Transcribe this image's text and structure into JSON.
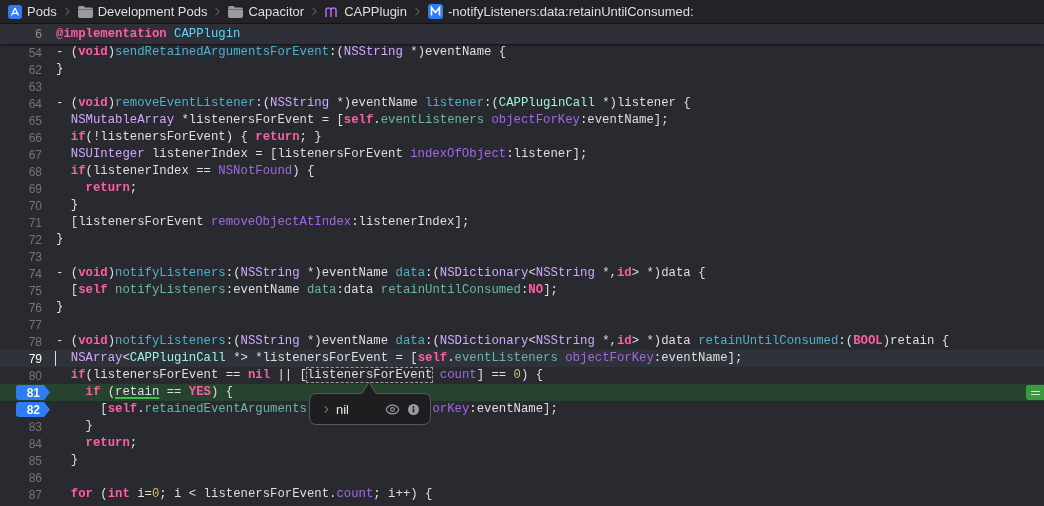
{
  "breadcrumbs": [
    {
      "kind": "project",
      "label": "Pods"
    },
    {
      "kind": "folder",
      "label": "Development Pods"
    },
    {
      "kind": "folder",
      "label": "Capacitor"
    },
    {
      "kind": "class",
      "label": "CAPPlugin"
    },
    {
      "kind": "method",
      "label": "-notifyListeners:data:retainUntilConsumed:"
    }
  ],
  "sticky_header": {
    "number": "6",
    "tokens": [
      {
        "kind": "kw",
        "text": "@implementation "
      },
      {
        "kind": "cls",
        "text": "CAPPlugin"
      }
    ]
  },
  "lines": [
    {
      "number": "54",
      "breakpoint": false,
      "current": false,
      "focused": false,
      "tokens": [
        {
          "kind": "p",
          "text": "- ("
        },
        {
          "kind": "kw",
          "text": "void"
        },
        {
          "kind": "p",
          "text": ")"
        },
        {
          "kind": "decl",
          "text": "sendRetainedArgumentsForEvent"
        },
        {
          "kind": "p",
          "text": ":("
        },
        {
          "kind": "sys",
          "text": "NSString"
        },
        {
          "kind": "p",
          "text": " *)eventName {"
        }
      ]
    },
    {
      "number": "62",
      "breakpoint": false,
      "current": false,
      "focused": false,
      "tokens": [
        {
          "kind": "p",
          "text": "}"
        }
      ]
    },
    {
      "number": "63",
      "breakpoint": false,
      "current": false,
      "focused": false
    },
    {
      "number": "64",
      "breakpoint": false,
      "current": false,
      "focused": false,
      "tokens": [
        {
          "kind": "p",
          "text": "- ("
        },
        {
          "kind": "kw",
          "text": "void"
        },
        {
          "kind": "p",
          "text": ")"
        },
        {
          "kind": "decl",
          "text": "removeEventListener"
        },
        {
          "kind": "p",
          "text": ":("
        },
        {
          "kind": "sys",
          "text": "NSString"
        },
        {
          "kind": "p",
          "text": " *)eventName "
        },
        {
          "kind": "decl",
          "text": "listener"
        },
        {
          "kind": "p",
          "text": ":("
        },
        {
          "kind": "proj",
          "text": "CAPPluginCall"
        },
        {
          "kind": "p",
          "text": " *)listener {"
        }
      ]
    },
    {
      "number": "65",
      "breakpoint": false,
      "current": false,
      "focused": false,
      "tokens": [
        {
          "kind": "sys",
          "text": "  NSMutableArray"
        },
        {
          "kind": "p",
          "text": " *listenersForEvent = ["
        },
        {
          "kind": "kw",
          "text": "self"
        },
        {
          "kind": "p",
          "text": "."
        },
        {
          "kind": "mem",
          "text": "eventListeners"
        },
        {
          "kind": "call",
          "text": " objectForKey"
        },
        {
          "kind": "p",
          "text": ":eventName];"
        }
      ]
    },
    {
      "number": "66",
      "breakpoint": false,
      "current": false,
      "focused": false,
      "tokens": [
        {
          "kind": "kw",
          "text": "  if"
        },
        {
          "kind": "p",
          "text": "(!listenersForEvent) { "
        },
        {
          "kind": "kw",
          "text": "return"
        },
        {
          "kind": "p",
          "text": "; }"
        }
      ]
    },
    {
      "number": "67",
      "breakpoint": false,
      "current": false,
      "focused": false,
      "tokens": [
        {
          "kind": "sys",
          "text": "  NSUInteger"
        },
        {
          "kind": "p",
          "text": " listenerIndex = [listenersForEvent "
        },
        {
          "kind": "call",
          "text": "indexOfObject"
        },
        {
          "kind": "p",
          "text": ":listener];"
        }
      ]
    },
    {
      "number": "68",
      "breakpoint": false,
      "current": false,
      "focused": false,
      "tokens": [
        {
          "kind": "kw",
          "text": "  if"
        },
        {
          "kind": "p",
          "text": "(listenerIndex == "
        },
        {
          "kind": "call",
          "text": "NSNotFound"
        },
        {
          "kind": "p",
          "text": ") {"
        }
      ]
    },
    {
      "number": "69",
      "breakpoint": false,
      "current": false,
      "focused": false,
      "tokens": [
        {
          "kind": "kw",
          "text": "    return"
        },
        {
          "kind": "p",
          "text": ";"
        }
      ]
    },
    {
      "number": "70",
      "breakpoint": false,
      "current": false,
      "focused": false,
      "tokens": [
        {
          "kind": "p",
          "text": "  }"
        }
      ]
    },
    {
      "number": "71",
      "breakpoint": false,
      "current": false,
      "focused": false,
      "tokens": [
        {
          "kind": "p",
          "text": "  [listenersForEvent "
        },
        {
          "kind": "call",
          "text": "removeObjectAtIndex"
        },
        {
          "kind": "p",
          "text": ":listenerIndex];"
        }
      ]
    },
    {
      "number": "72",
      "breakpoint": false,
      "current": false,
      "focused": false,
      "tokens": [
        {
          "kind": "p",
          "text": "}"
        }
      ]
    },
    {
      "number": "73",
      "breakpoint": false,
      "current": false,
      "focused": false
    },
    {
      "number": "74",
      "breakpoint": false,
      "current": false,
      "focused": false,
      "tokens": [
        {
          "kind": "p",
          "text": "- ("
        },
        {
          "kind": "kw",
          "text": "void"
        },
        {
          "kind": "p",
          "text": ")"
        },
        {
          "kind": "decl",
          "text": "notifyListeners"
        },
        {
          "kind": "p",
          "text": ":("
        },
        {
          "kind": "sys",
          "text": "NSString"
        },
        {
          "kind": "p",
          "text": " *)eventName "
        },
        {
          "kind": "decl",
          "text": "data"
        },
        {
          "kind": "p",
          "text": ":("
        },
        {
          "kind": "sys",
          "text": "NSDictionary"
        },
        {
          "kind": "p",
          "text": "<"
        },
        {
          "kind": "sys",
          "text": "NSString"
        },
        {
          "kind": "p",
          "text": " *,"
        },
        {
          "kind": "kw",
          "text": "id"
        },
        {
          "kind": "p",
          "text": "> *)data {"
        }
      ]
    },
    {
      "number": "75",
      "breakpoint": false,
      "current": false,
      "focused": false,
      "tokens": [
        {
          "kind": "p",
          "text": "  ["
        },
        {
          "kind": "kw",
          "text": "self"
        },
        {
          "kind": "mem",
          "text": " notifyListeners"
        },
        {
          "kind": "p",
          "text": ":eventName "
        },
        {
          "kind": "mem",
          "text": "data"
        },
        {
          "kind": "p",
          "text": ":data "
        },
        {
          "kind": "mem",
          "text": "retainUntilConsumed"
        },
        {
          "kind": "p",
          "text": ":"
        },
        {
          "kind": "kw",
          "text": "NO"
        },
        {
          "kind": "p",
          "text": "];"
        }
      ]
    },
    {
      "number": "76",
      "breakpoint": false,
      "current": false,
      "focused": false,
      "tokens": [
        {
          "kind": "p",
          "text": "}"
        }
      ]
    },
    {
      "number": "77",
      "breakpoint": false,
      "current": false,
      "focused": false
    },
    {
      "number": "78",
      "breakpoint": false,
      "current": false,
      "focused": false,
      "tokens": [
        {
          "kind": "p",
          "text": "- ("
        },
        {
          "kind": "kw",
          "text": "void"
        },
        {
          "kind": "p",
          "text": ")"
        },
        {
          "kind": "decl",
          "text": "notifyListeners"
        },
        {
          "kind": "p",
          "text": ":("
        },
        {
          "kind": "sys",
          "text": "NSString"
        },
        {
          "kind": "p",
          "text": " *)eventName "
        },
        {
          "kind": "decl",
          "text": "data"
        },
        {
          "kind": "p",
          "text": ":("
        },
        {
          "kind": "sys",
          "text": "NSDictionary"
        },
        {
          "kind": "p",
          "text": "<"
        },
        {
          "kind": "sys",
          "text": "NSString"
        },
        {
          "kind": "p",
          "text": " *,"
        },
        {
          "kind": "kw",
          "text": "id"
        },
        {
          "kind": "p",
          "text": "> *)data "
        },
        {
          "kind": "decl",
          "text": "retainUntilConsumed"
        },
        {
          "kind": "p",
          "text": ":("
        },
        {
          "kind": "kw",
          "text": "BOOL"
        },
        {
          "kind": "p",
          "text": ")retain {"
        }
      ]
    },
    {
      "number": "79",
      "breakpoint": false,
      "current": false,
      "focused": true,
      "tokens": [
        {
          "kind": "sys",
          "text": "  NSArray"
        },
        {
          "kind": "p",
          "text": "<"
        },
        {
          "kind": "proj",
          "text": "CAPPluginCall"
        },
        {
          "kind": "p",
          "text": " *> *listenersForEvent = ["
        },
        {
          "kind": "kw",
          "text": "self"
        },
        {
          "kind": "p",
          "text": "."
        },
        {
          "kind": "mem",
          "text": "eventListeners"
        },
        {
          "kind": "call",
          "text": " objectForKey"
        },
        {
          "kind": "p",
          "text": ":eventName];"
        }
      ]
    },
    {
      "number": "80",
      "breakpoint": false,
      "current": false,
      "focused": false,
      "tokens": [
        {
          "kind": "kw",
          "text": "  if"
        },
        {
          "kind": "p",
          "text": "(listenersForEvent == "
        },
        {
          "kind": "kw",
          "text": "nil"
        },
        {
          "kind": "p",
          "text": " || ["
        },
        {
          "kind": "hover",
          "text": "listenersForEvent"
        },
        {
          "kind": "call",
          "text": " count"
        },
        {
          "kind": "p",
          "text": "] == "
        },
        {
          "kind": "num",
          "text": "0"
        },
        {
          "kind": "p",
          "text": ") {"
        }
      ]
    },
    {
      "number": "81",
      "breakpoint": true,
      "current": true,
      "focused": false,
      "tokens": [
        {
          "kind": "kw",
          "text": "    if"
        },
        {
          "kind": "p",
          "text": " ("
        },
        {
          "kind": "under",
          "text": "retain"
        },
        {
          "kind": "p",
          "text": " == "
        },
        {
          "kind": "kw",
          "text": "YES"
        },
        {
          "kind": "p",
          "text": ") {"
        }
      ]
    },
    {
      "number": "82",
      "breakpoint": true,
      "current": false,
      "focused": false,
      "tokens": [
        {
          "kind": "p",
          "text": "      ["
        },
        {
          "kind": "kw",
          "text": "self"
        },
        {
          "kind": "p",
          "text": "."
        },
        {
          "kind": "mem",
          "text": "retainedEventArguments"
        },
        {
          "kind": "covered"
        },
        {
          "kind": "call",
          "text": "orKey"
        },
        {
          "kind": "p",
          "text": ":eventName];"
        }
      ]
    },
    {
      "number": "83",
      "breakpoint": false,
      "current": false,
      "focused": false,
      "tokens": [
        {
          "kind": "p",
          "text": "    }"
        }
      ]
    },
    {
      "number": "84",
      "breakpoint": false,
      "current": false,
      "focused": false,
      "tokens": [
        {
          "kind": "kw",
          "text": "    return"
        },
        {
          "kind": "p",
          "text": ";"
        }
      ]
    },
    {
      "number": "85",
      "breakpoint": false,
      "current": false,
      "focused": false,
      "tokens": [
        {
          "kind": "p",
          "text": "  }"
        }
      ]
    },
    {
      "number": "86",
      "breakpoint": false,
      "current": false,
      "focused": false
    },
    {
      "number": "87",
      "breakpoint": false,
      "current": false,
      "focused": false,
      "tokens": [
        {
          "kind": "kw",
          "text": "  for"
        },
        {
          "kind": "p",
          "text": " ("
        },
        {
          "kind": "kw",
          "text": "int"
        },
        {
          "kind": "p",
          "text": " i="
        },
        {
          "kind": "num",
          "text": "0"
        },
        {
          "kind": "p",
          "text": "; i < listenersForEvent."
        },
        {
          "kind": "call",
          "text": "count"
        },
        {
          "kind": "p",
          "text": "; i++) {"
        }
      ]
    }
  ],
  "popover": {
    "value": "nil"
  }
}
